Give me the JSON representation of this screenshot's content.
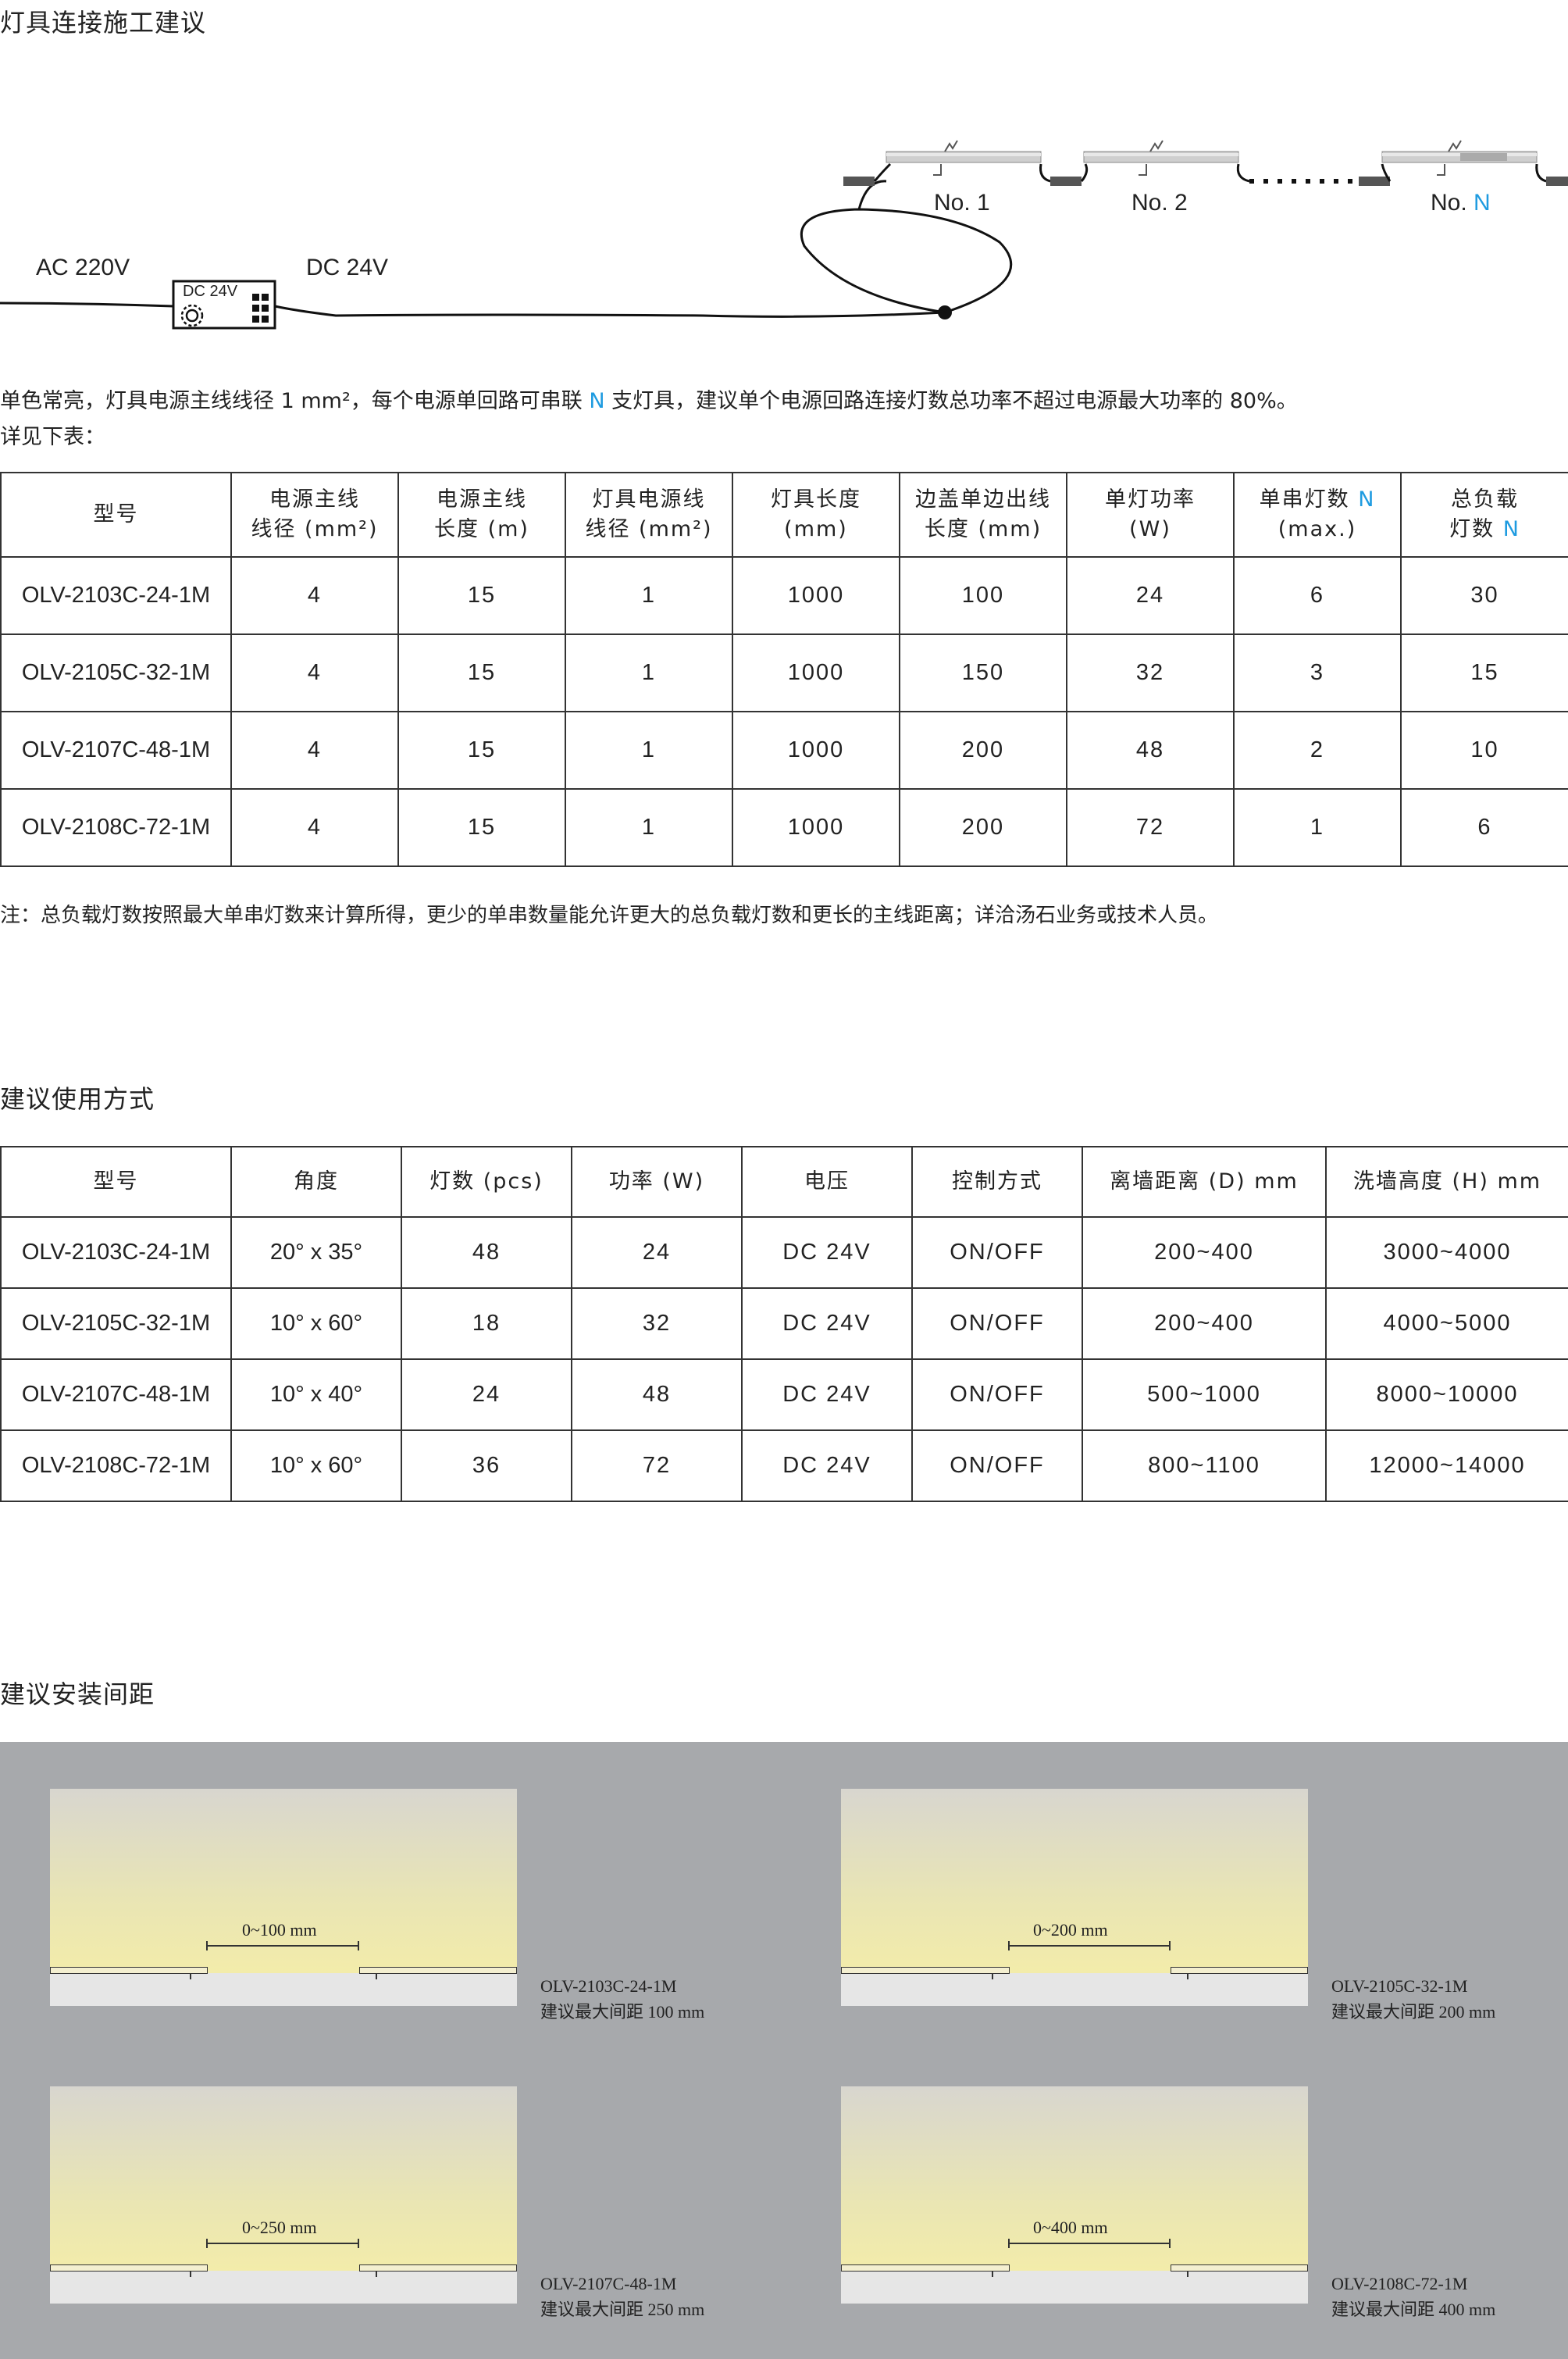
{
  "section1": {
    "title": "灯具连接施工建议",
    "diagram": {
      "ac_label": "AC 220V",
      "dc_label": "DC 24V",
      "driver_label": "DC 24V",
      "nodes": [
        "No. 1",
        "No. 2"
      ],
      "last_node_prefix": "No. ",
      "last_node_suffix": "N"
    },
    "note1_a": "单色常亮，灯具电源主线线径 1 mm²，每个电源单回路可串联 ",
    "note1_n": "N",
    "note1_b": " 支灯具，建议单个电源回路连接灯数总功率不超过电源最大功率的 80%。",
    "note2": "详见下表：",
    "table": {
      "headers": [
        {
          "l1": "型号",
          "l2": ""
        },
        {
          "l1": "电源主线",
          "l2": "线径 (mm²)"
        },
        {
          "l1": "电源主线",
          "l2": "长度 (m)"
        },
        {
          "l1": "灯具电源线",
          "l2": "线径 (mm²)"
        },
        {
          "l1": "灯具长度",
          "l2": "(mm)"
        },
        {
          "l1": "边盖单边出线",
          "l2": "长度 (mm)"
        },
        {
          "l1": "单灯功率",
          "l2": "(W)"
        },
        {
          "l1": "单串灯数 ",
          "l1n": "N",
          "l2": "(max.)"
        },
        {
          "l1": "总负载",
          "l2": "灯数 ",
          "l2n": "N"
        }
      ],
      "rows": [
        [
          "OLV-2103C-24-1M",
          "4",
          "15",
          "1",
          "1000",
          "100",
          "24",
          "6",
          "30"
        ],
        [
          "OLV-2105C-32-1M",
          "4",
          "15",
          "1",
          "1000",
          "150",
          "32",
          "3",
          "15"
        ],
        [
          "OLV-2107C-48-1M",
          "4",
          "15",
          "1",
          "1000",
          "200",
          "48",
          "2",
          "10"
        ],
        [
          "OLV-2108C-72-1M",
          "4",
          "15",
          "1",
          "1000",
          "200",
          "72",
          "1",
          "6"
        ]
      ]
    },
    "footnote": "注：总负载灯数按照最大单串灯数来计算所得，更少的单串数量能允许更大的总负载灯数和更长的主线距离；详洽汤石业务或技术人员。"
  },
  "section2": {
    "title": "建议使用方式",
    "table": {
      "headers": [
        "型号",
        "角度",
        "灯数 (pcs)",
        "功率 (W)",
        "电压",
        "控制方式",
        "离墙距离 (D) mm",
        "洗墙高度 (H) mm"
      ],
      "rows": [
        [
          "OLV-2103C-24-1M",
          "20° x 35°",
          "48",
          "24",
          "DC 24V",
          "ON/OFF",
          "200~400",
          "3000~4000"
        ],
        [
          "OLV-2105C-32-1M",
          "10° x 60°",
          "18",
          "32",
          "DC 24V",
          "ON/OFF",
          "200~400",
          "4000~5000"
        ],
        [
          "OLV-2107C-48-1M",
          "10° x 40°",
          "24",
          "48",
          "DC 24V",
          "ON/OFF",
          "500~1000",
          "8000~10000"
        ],
        [
          "OLV-2108C-72-1M",
          "10° x 60°",
          "36",
          "72",
          "DC 24V",
          "ON/OFF",
          "800~1100",
          "12000~14000"
        ]
      ]
    }
  },
  "section3": {
    "title": "建议安装间距",
    "cards": [
      {
        "gap": "0~100 mm",
        "model": "OLV-2103C-24-1M",
        "desc": "建议最大间距 100 mm"
      },
      {
        "gap": "0~200 mm",
        "model": "OLV-2105C-32-1M",
        "desc": "建议最大间距 200 mm"
      },
      {
        "gap": "0~250 mm",
        "model": "OLV-2107C-48-1M",
        "desc": "建议最大间距 250 mm"
      },
      {
        "gap": "0~400 mm",
        "model": "OLV-2108C-72-1M",
        "desc": "建议最大间距 400 mm"
      }
    ]
  },
  "colors": {
    "accent": "#1e9be0",
    "panel": "#a7a9ac"
  }
}
